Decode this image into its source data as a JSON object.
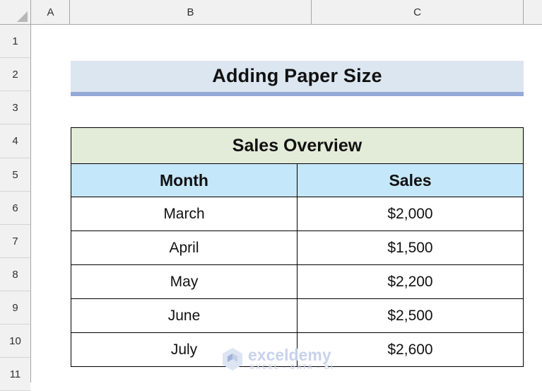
{
  "app": {
    "type": "spreadsheet",
    "select_all_label": "Select All"
  },
  "columns": [
    {
      "label": "A",
      "name": "column-header-a"
    },
    {
      "label": "B",
      "name": "column-header-b"
    },
    {
      "label": "C",
      "name": "column-header-c"
    }
  ],
  "rows": [
    {
      "label": "1"
    },
    {
      "label": "2"
    },
    {
      "label": "3"
    },
    {
      "label": "4"
    },
    {
      "label": "5"
    },
    {
      "label": "6"
    },
    {
      "label": "7"
    },
    {
      "label": "8"
    },
    {
      "label": "9"
    },
    {
      "label": "10"
    },
    {
      "label": "11"
    }
  ],
  "banner": {
    "title": "Adding Paper Size",
    "background_color": "#dce6f1",
    "accent_color": "#95a9d8"
  },
  "table": {
    "title": "Sales Overview",
    "title_background_color": "#e3ecd9",
    "header_background_color": "#c5e7fa",
    "headers": [
      {
        "label": "Month"
      },
      {
        "label": "Sales"
      }
    ],
    "rows": [
      {
        "month": "March",
        "sales": "$2,000"
      },
      {
        "month": "April",
        "sales": "$1,500"
      },
      {
        "month": "May",
        "sales": "$2,200"
      },
      {
        "month": "June",
        "sales": "$2,500"
      },
      {
        "month": "July",
        "sales": "$2,600"
      }
    ]
  },
  "watermark": {
    "brand": "exceldemy",
    "tagline": "EXCEL - DATA - BI",
    "color": "#c8d2ec"
  }
}
